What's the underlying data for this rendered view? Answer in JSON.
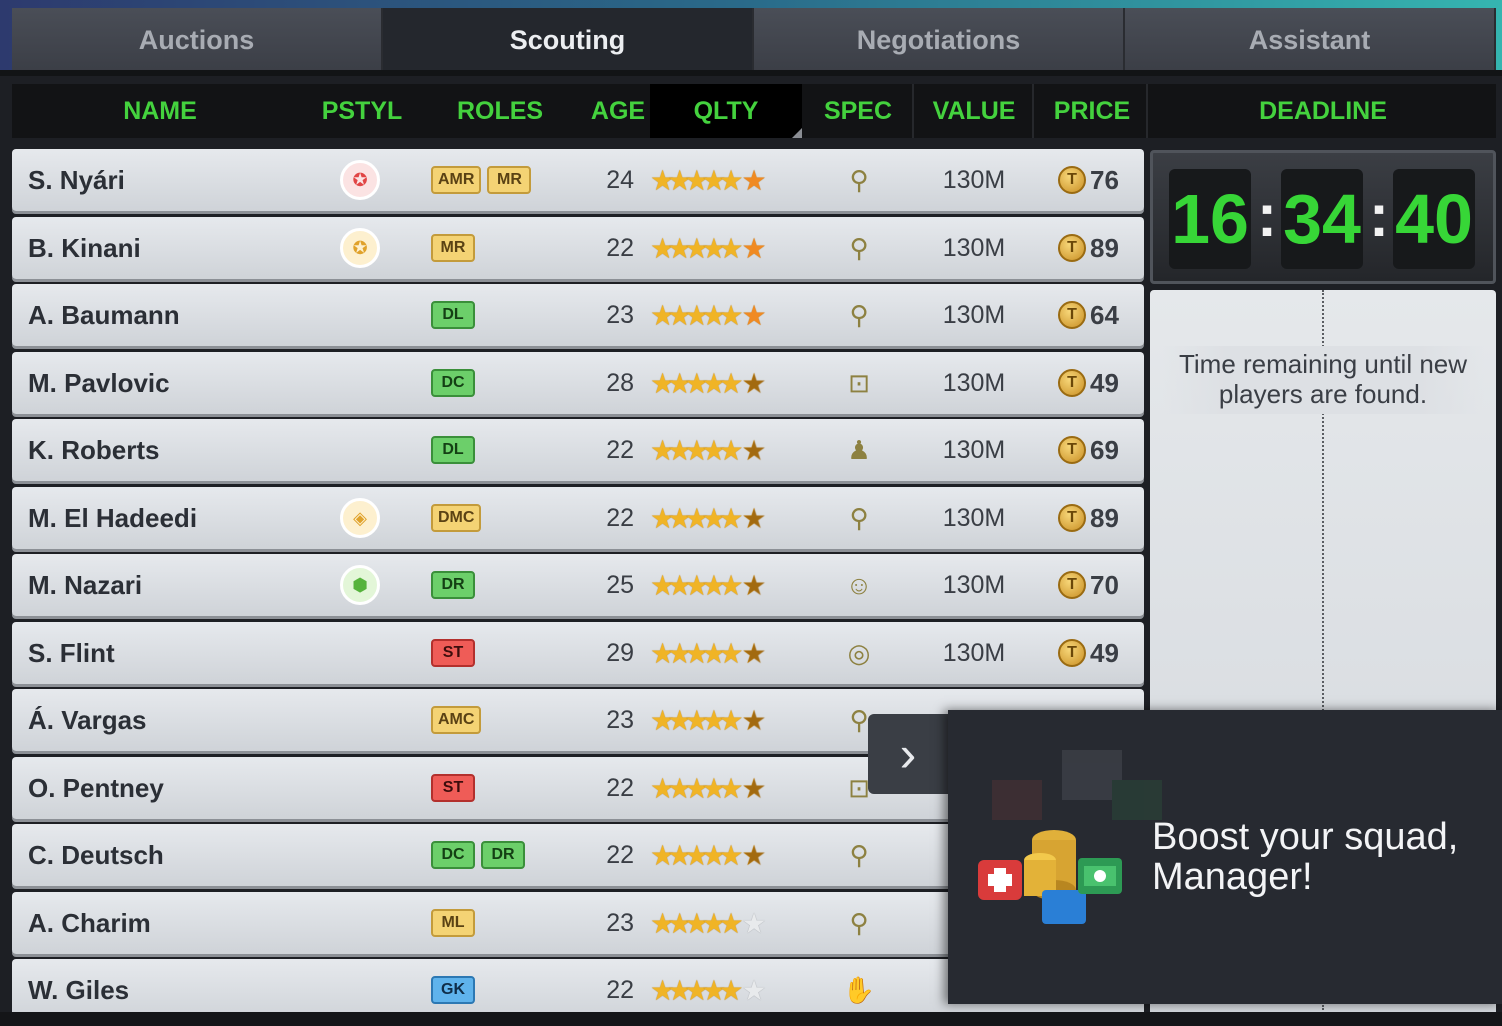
{
  "tabs": [
    {
      "label": "Auctions",
      "active": false
    },
    {
      "label": "Scouting",
      "active": true
    },
    {
      "label": "Negotiations",
      "active": false
    },
    {
      "label": "Assistant",
      "active": false
    }
  ],
  "columns": {
    "name": "NAME",
    "pstyl": "PSTYL",
    "roles": "ROLES",
    "age": "AGE",
    "qlty": "QLTY",
    "spec": "SPEC",
    "value": "VALUE",
    "price": "PRICE",
    "deadline": "DEADLINE"
  },
  "players": [
    {
      "name": "S. Nyári",
      "pstyl": "red-wings-icon",
      "roles": [
        {
          "r": "AMR",
          "c": "yellow"
        },
        {
          "r": "MR",
          "c": "yellow"
        }
      ],
      "age": "24",
      "last_star": "full",
      "spec": "whistle-icon",
      "value": "130M",
      "price": "76"
    },
    {
      "name": "B. Kinani",
      "pstyl": "orange-wings-icon",
      "roles": [
        {
          "r": "MR",
          "c": "yellow"
        }
      ],
      "age": "22",
      "last_star": "full",
      "spec": "whistle-icon",
      "value": "130M",
      "price": "89"
    },
    {
      "name": "A. Baumann",
      "pstyl": "",
      "roles": [
        {
          "r": "DL",
          "c": "green"
        }
      ],
      "age": "23",
      "last_star": "full",
      "spec": "whistle-icon",
      "value": "130M",
      "price": "64"
    },
    {
      "name": "M. Pavlovic",
      "pstyl": "",
      "roles": [
        {
          "r": "DC",
          "c": "green"
        }
      ],
      "age": "28",
      "last_star": "half",
      "spec": "goal-icon",
      "value": "130M",
      "price": "49"
    },
    {
      "name": "K. Roberts",
      "pstyl": "",
      "roles": [
        {
          "r": "DL",
          "c": "green"
        }
      ],
      "age": "22",
      "last_star": "half",
      "spec": "player-whistle-icon",
      "value": "130M",
      "price": "69"
    },
    {
      "name": "M. El Hadeedi",
      "pstyl": "orange-ball-icon",
      "roles": [
        {
          "r": "DMC",
          "c": "yellow"
        }
      ],
      "age": "22",
      "last_star": "half",
      "spec": "whistle-icon",
      "value": "130M",
      "price": "89"
    },
    {
      "name": "M. Nazari",
      "pstyl": "green-shield-icon",
      "roles": [
        {
          "r": "DR",
          "c": "green"
        }
      ],
      "age": "25",
      "last_star": "half",
      "spec": "team-icon",
      "value": "130M",
      "price": "70"
    },
    {
      "name": "S. Flint",
      "pstyl": "",
      "roles": [
        {
          "r": "ST",
          "c": "red"
        }
      ],
      "age": "29",
      "last_star": "half",
      "spec": "target-icon",
      "value": "130M",
      "price": "49"
    },
    {
      "name": "Á. Vargas",
      "pstyl": "",
      "roles": [
        {
          "r": "AMC",
          "c": "yellow"
        }
      ],
      "age": "23",
      "last_star": "half",
      "spec": "whistle-icon",
      "value": "",
      "price": ""
    },
    {
      "name": "O. Pentney",
      "pstyl": "",
      "roles": [
        {
          "r": "ST",
          "c": "red"
        }
      ],
      "age": "22",
      "last_star": "half",
      "spec": "goal-icon",
      "value": "",
      "price": ""
    },
    {
      "name": "C. Deutsch",
      "pstyl": "",
      "roles": [
        {
          "r": "DC",
          "c": "green"
        },
        {
          "r": "DR",
          "c": "green"
        }
      ],
      "age": "22",
      "last_star": "half",
      "spec": "whistle-icon",
      "value": "",
      "price": ""
    },
    {
      "name": "A. Charim",
      "pstyl": "",
      "roles": [
        {
          "r": "ML",
          "c": "yellow"
        }
      ],
      "age": "23",
      "last_star": "grey",
      "spec": "whistle-icon",
      "value": "",
      "price": ""
    },
    {
      "name": "W. Giles",
      "pstyl": "",
      "roles": [
        {
          "r": "GK",
          "c": "blue"
        }
      ],
      "age": "22",
      "last_star": "grey",
      "spec": "glove-icon",
      "value": "",
      "price": ""
    }
  ],
  "timer": {
    "h": "16",
    "m": "34",
    "s": "40"
  },
  "deadline_text": "Time remaining until new players are found.",
  "popup": {
    "text": "Boost your squad, Manager!",
    "arrow": "›"
  },
  "colors": {
    "header_green": "#44d23e",
    "timer_green": "#37d637",
    "active_tab": "#24272d"
  }
}
